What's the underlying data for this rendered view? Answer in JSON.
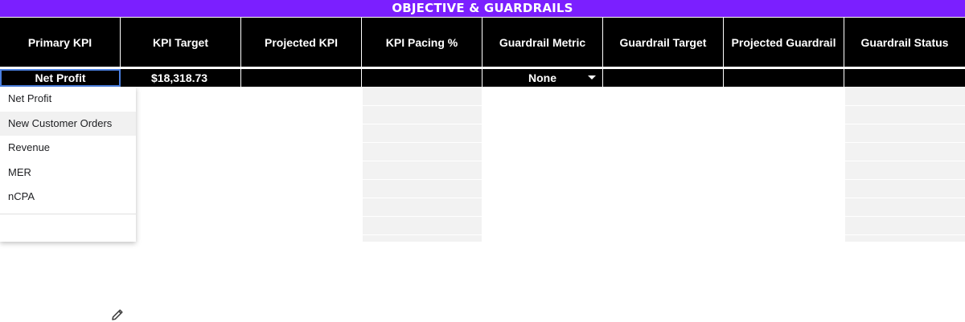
{
  "banner": {
    "title": "OBJECTIVE & GUARDRAILS"
  },
  "headers": [
    "Primary KPI",
    "KPI Target",
    "Projected KPI",
    "KPI Pacing %",
    "Guardrail Metric",
    "Guardrail Target",
    "Projected Guardrail",
    "Guardrail Status"
  ],
  "row": {
    "primary_kpi": "Net Profit",
    "kpi_target": "$18,318.73",
    "projected_kpi": "",
    "kpi_pacing": "",
    "guardrail_metric": "None",
    "guardrail_target": "",
    "projected_guardrail": "",
    "guardrail_status": ""
  },
  "dropdown": {
    "options": [
      "Net Profit",
      "New Customer Orders",
      "Revenue",
      "MER",
      "nCPA"
    ],
    "hovered": "New Customer Orders",
    "edit_icon": "pencil-icon"
  },
  "colors": {
    "banner": "#7b1fff",
    "header_bg": "#000000",
    "selection": "#4a7fe0",
    "shaded_column": "#f2f2f2"
  }
}
